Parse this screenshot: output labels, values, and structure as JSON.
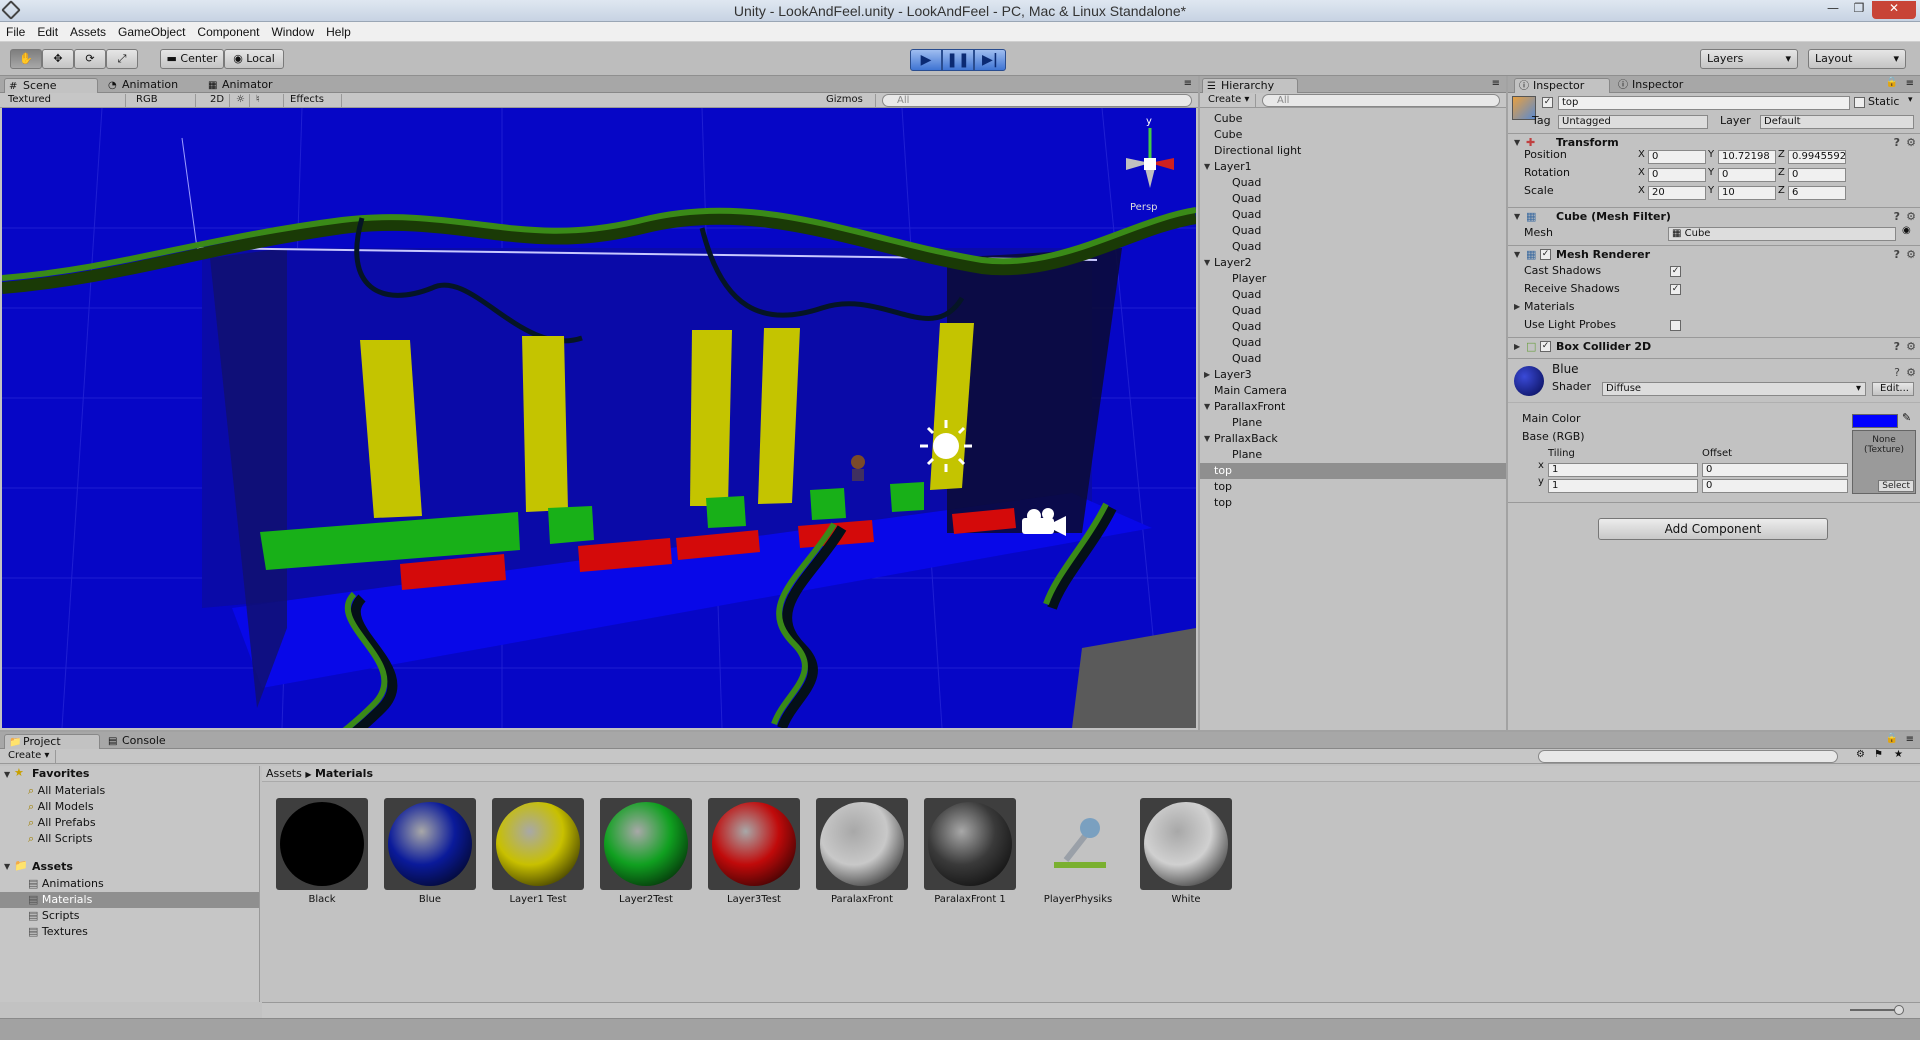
{
  "window": {
    "title": "Unity - LookAndFeel.unity - LookAndFeel - PC, Mac & Linux Standalone*"
  },
  "menu": [
    "File",
    "Edit",
    "Assets",
    "GameObject",
    "Component",
    "Window",
    "Help"
  ],
  "toolbar": {
    "pivot": "Center",
    "space": "Local",
    "layers": "Layers",
    "layout": "Layout"
  },
  "scene_panel": {
    "tabs": [
      "Scene",
      "Animation",
      "Animator"
    ],
    "render_mode": "Textured",
    "color_mode": "RGB",
    "mode_2d": "2D",
    "effects": "Effects",
    "gizmos": "Gizmos",
    "search_placeholder": "All",
    "persp_label": "Persp",
    "gizmo_y": "y"
  },
  "hierarchy": {
    "tab": "Hierarchy",
    "create": "Create",
    "search_placeholder": "All",
    "items": [
      "Cube",
      "Cube",
      "Directional light",
      "Layer1",
      "Quad",
      "Quad",
      "Quad",
      "Quad",
      "Quad",
      "Layer2",
      "Player",
      "Quad",
      "Quad",
      "Quad",
      "Quad",
      "Quad",
      "Layer3",
      "Main Camera",
      "ParallaxFront",
      "Plane",
      "PrallaxBack",
      "Plane",
      "top",
      "top",
      "top"
    ]
  },
  "inspector": {
    "tabs": [
      "Inspector",
      "Inspector"
    ],
    "object_name": "top",
    "static_label": "Static",
    "tag_label": "Tag",
    "tag_value": "Untagged",
    "layer_label": "Layer",
    "layer_value": "Default",
    "transform": {
      "title": "Transform",
      "position_label": "Position",
      "rotation_label": "Rotation",
      "scale_label": "Scale",
      "position": [
        "0",
        "10.72198",
        "0.9945592"
      ],
      "rotation": [
        "0",
        "0",
        "0"
      ],
      "scale": [
        "20",
        "10",
        "6"
      ],
      "axes": [
        "X",
        "Y",
        "Z"
      ]
    },
    "mesh_filter": {
      "title": "Cube (Mesh Filter)",
      "mesh_label": "Mesh",
      "mesh_value": "Cube"
    },
    "mesh_renderer": {
      "title": "Mesh Renderer",
      "cast_shadows": "Cast Shadows",
      "receive_shadows": "Receive Shadows",
      "materials": "Materials",
      "light_probes": "Use Light Probes"
    },
    "box_collider": {
      "title": "Box Collider 2D"
    },
    "material": {
      "name": "Blue",
      "shader_label": "Shader",
      "shader_value": "Diffuse",
      "edit_label": "Edit...",
      "main_color_label": "Main Color",
      "main_color": "#0000ff",
      "base_label": "Base (RGB)",
      "tiling_label": "Tiling",
      "offset_label": "Offset",
      "tiling": [
        "1",
        "1"
      ],
      "offset": [
        "0",
        "0"
      ],
      "xy": [
        "x",
        "y"
      ],
      "texture_none": "None",
      "texture_kind": "(Texture)",
      "select_label": "Select"
    },
    "add_component": "Add Component"
  },
  "project": {
    "tabs": [
      "Project",
      "Console"
    ],
    "create": "Create",
    "favorites_label": "Favorites",
    "favorites": [
      "All Materials",
      "All Models",
      "All Prefabs",
      "All Scripts"
    ],
    "assets_label": "Assets",
    "folders": [
      "Animations",
      "Materials",
      "Scripts",
      "Textures"
    ],
    "breadcrumb": [
      "Assets",
      "Materials"
    ],
    "assets": [
      {
        "name": "Black",
        "color": "#000000"
      },
      {
        "name": "Blue",
        "color": "#0a1a9a"
      },
      {
        "name": "Layer1 Test",
        "color": "#c8c000"
      },
      {
        "name": "Layer2Test",
        "color": "#10a020"
      },
      {
        "name": "Layer3Test",
        "color": "#c00a0a"
      },
      {
        "name": "ParalaxFront",
        "color": "#c8c8c8"
      },
      {
        "name": "ParalaxFront 1",
        "color": "#3a3a3a"
      },
      {
        "name": "PlayerPhysiks",
        "color": "#7aa0c0"
      },
      {
        "name": "White",
        "color": "#d0d0d0"
      }
    ]
  }
}
